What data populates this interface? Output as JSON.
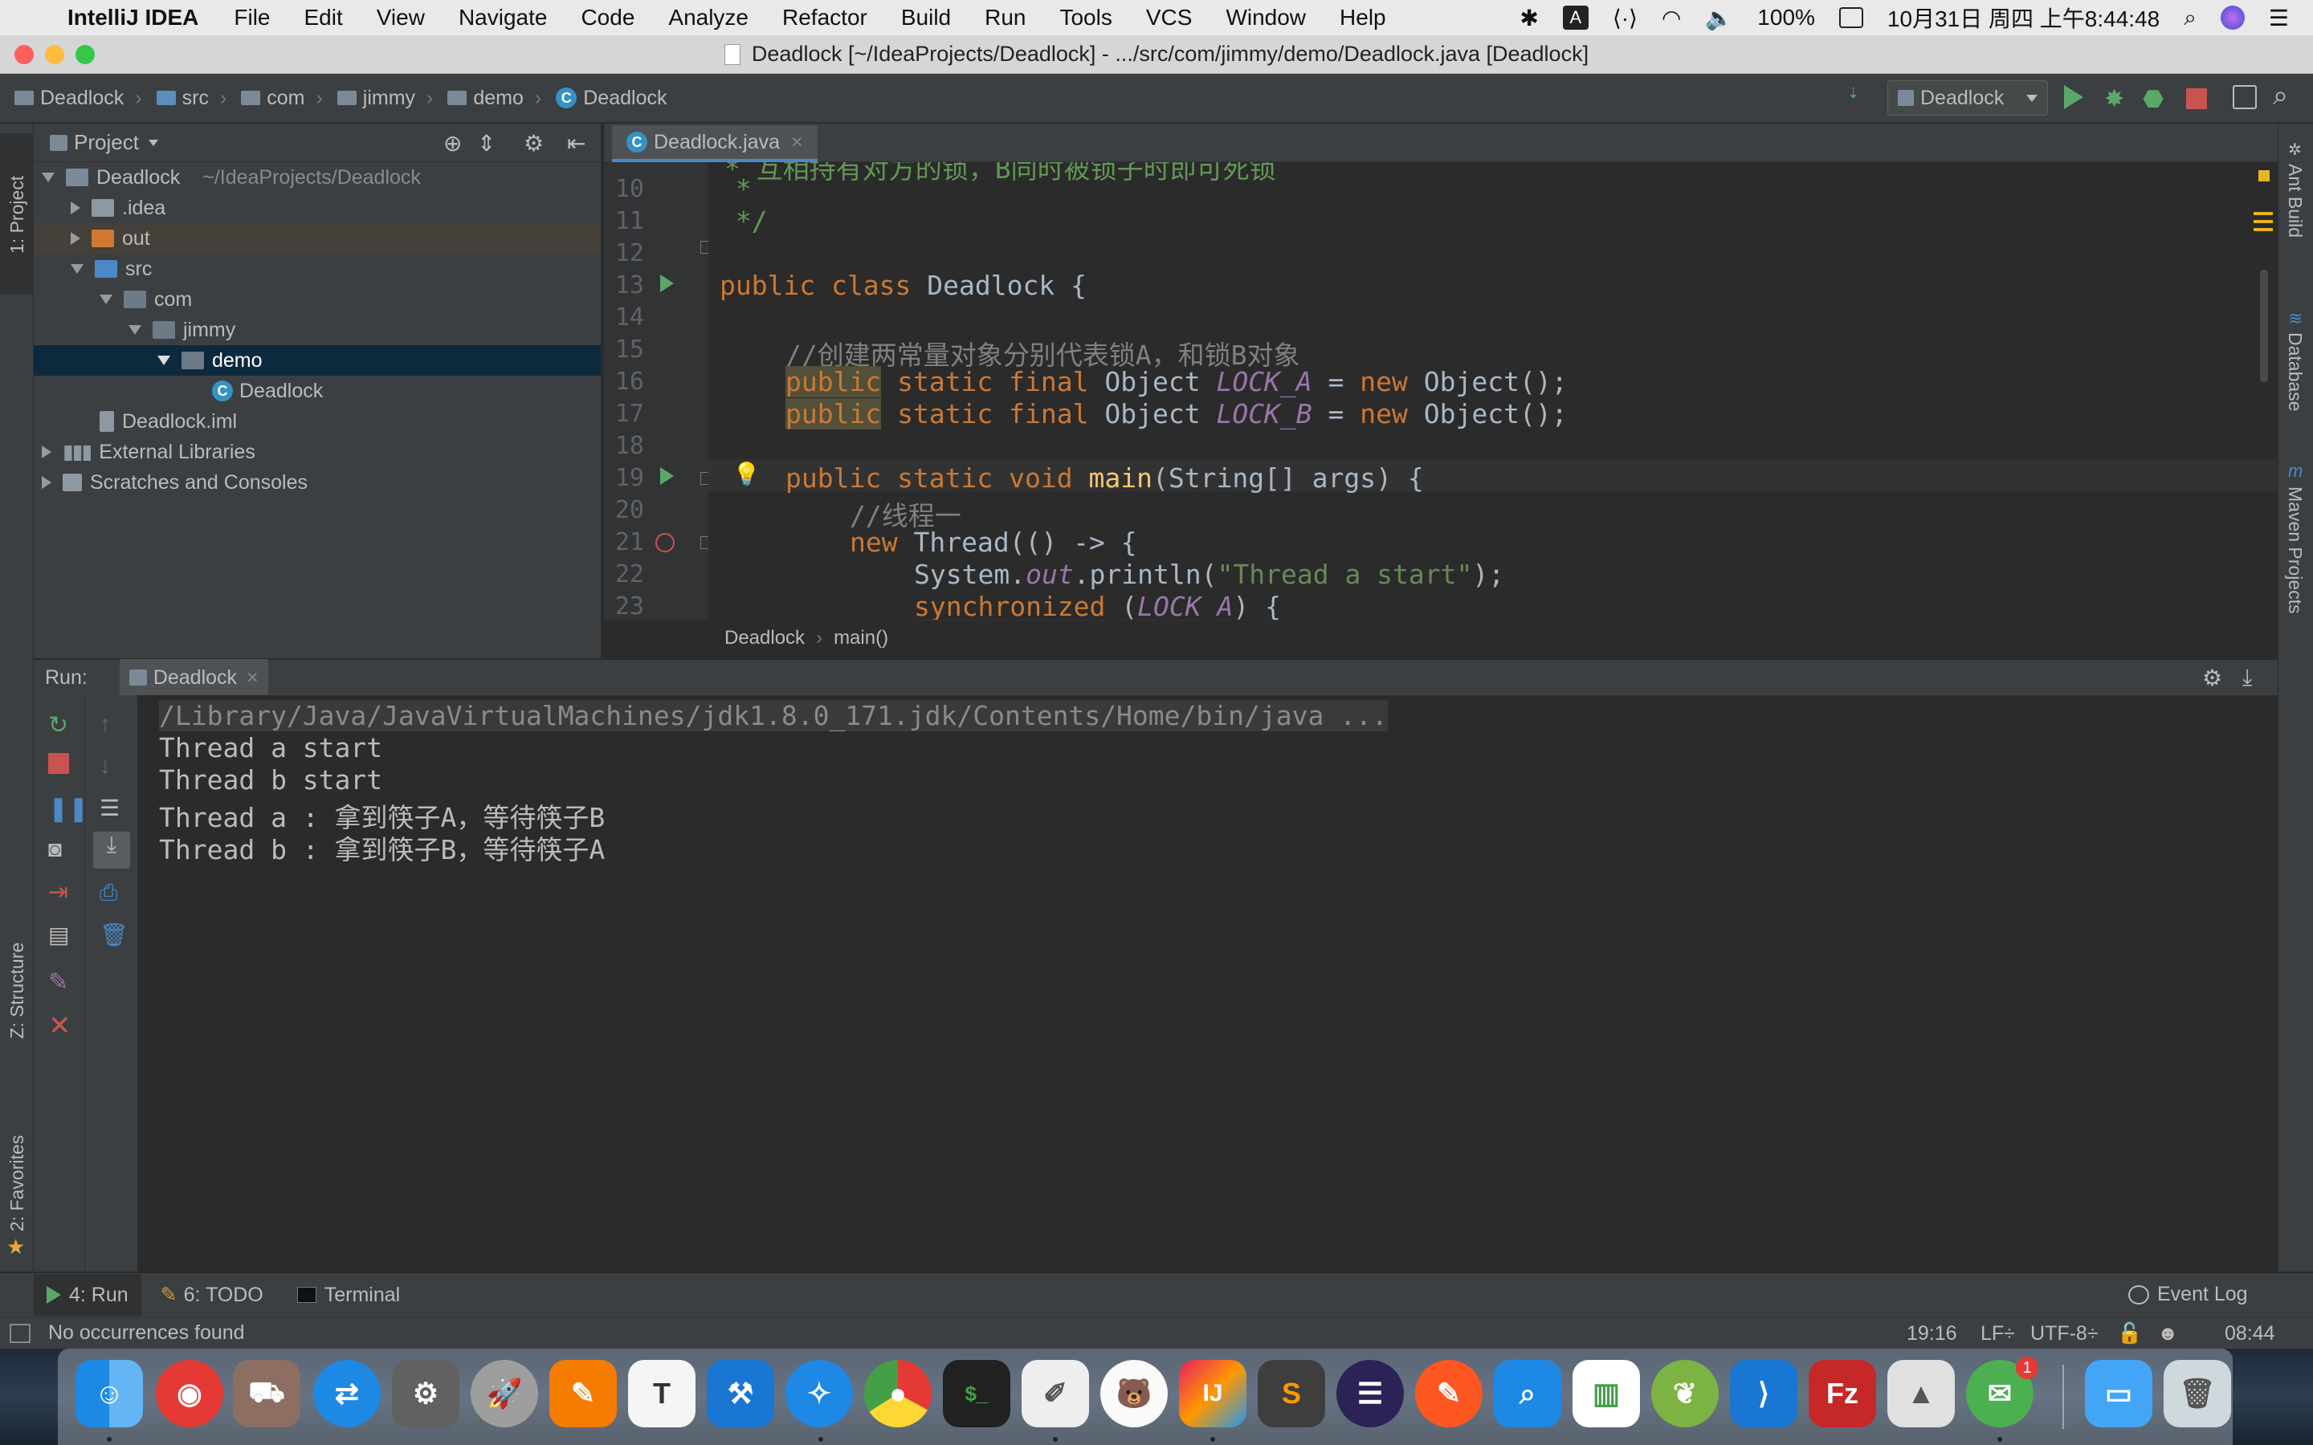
{
  "menubar": {
    "app_name": "IntelliJ IDEA",
    "items": [
      "File",
      "Edit",
      "View",
      "Navigate",
      "Code",
      "Analyze",
      "Refactor",
      "Build",
      "Run",
      "Tools",
      "VCS",
      "Window",
      "Help"
    ],
    "battery": "100%",
    "input_indicator": "A",
    "clock": "10月31日 周四 上午8:44:48"
  },
  "window": {
    "title": "Deadlock [~/IdeaProjects/Deadlock] - .../src/com/jimmy/demo/Deadlock.java [Deadlock]"
  },
  "navbar": {
    "crumbs": [
      "Deadlock",
      "src",
      "com",
      "jimmy",
      "demo",
      "Deadlock"
    ],
    "run_config": "Deadlock"
  },
  "left_strip": {
    "project": "1: Project",
    "structure": "Z: Structure",
    "favorites": "2: Favorites"
  },
  "right_strip": {
    "ant": "Ant Build",
    "database": "Database",
    "maven": "Maven Projects"
  },
  "project_panel": {
    "title": "Project",
    "tree": [
      {
        "label": "Deadlock",
        "path": "~/IdeaProjects/Deadlock",
        "icon": "module-folder-icon",
        "expanded": true
      },
      {
        "label": ".idea",
        "icon": "folder-icon",
        "expanded": false
      },
      {
        "label": "out",
        "icon": "excluded-folder-icon",
        "expanded": false
      },
      {
        "label": "src",
        "icon": "source-folder-icon",
        "expanded": true
      },
      {
        "label": "com",
        "icon": "package-icon",
        "expanded": true
      },
      {
        "label": "jimmy",
        "icon": "package-icon",
        "expanded": true
      },
      {
        "label": "demo",
        "icon": "package-icon",
        "expanded": true,
        "selected": true
      },
      {
        "label": "Deadlock",
        "icon": "java-class-icon"
      },
      {
        "label": "Deadlock.iml",
        "icon": "iml-file-icon"
      },
      {
        "label": "External Libraries",
        "icon": "libraries-icon",
        "expanded": false
      },
      {
        "label": "Scratches and Consoles",
        "icon": "scratches-icon",
        "expanded": false
      }
    ]
  },
  "editor": {
    "tab": "Deadlock.java",
    "line_numbers": [
      "10",
      "11",
      "12",
      "13",
      "14",
      "15",
      "16",
      "17",
      "18",
      "19",
      "20",
      "21",
      "22",
      "23"
    ],
    "partial_top_line": "* 互相持有对方的锁，B同时被锁子时即可死锁",
    "code": {
      "l10": " *",
      "l11": " */",
      "l13a": "public class ",
      "l13b": "Deadlock {",
      "l15": "//创建两常量对象分别代表锁A，和锁B对象",
      "l16a": "public",
      "l16b": " static final ",
      "l16c": "Object ",
      "l16d": "LOCK_A",
      "l16e": " = ",
      "l16f": "new ",
      "l16g": "Object();",
      "l17a": "public",
      "l17b": " static final ",
      "l17c": "Object ",
      "l17d": "LOCK_B",
      "l17e": " = ",
      "l17f": "new ",
      "l17g": "Object();",
      "l19a": "public static void ",
      "l19b": "main",
      "l19c": "(String[] args) {",
      "l20": "//线程一",
      "l21a": "new ",
      "l21b": "Thread(() -> {",
      "l22a": "System.",
      "l22b": "out",
      "l22c": ".println(",
      "l22d": "\"Thread a start\"",
      "l22e": ");",
      "l23a": "synchronized ",
      "l23b": "(",
      "l23c": "LOCK_A",
      "l23d": ") {"
    },
    "breadcrumb": [
      "Deadlock",
      "main()"
    ]
  },
  "run_panel": {
    "label": "Run:",
    "tab": "Deadlock",
    "output": [
      "/Library/Java/JavaVirtualMachines/jdk1.8.0_171.jdk/Contents/Home/bin/java ...",
      "Thread a start",
      "Thread b start",
      "Thread a : 拿到筷子A，等待筷子B",
      "Thread b : 拿到筷子B，等待筷子A"
    ]
  },
  "bottom_bar": {
    "run_tab": "4: Run",
    "todo_tab": "6: TODO",
    "terminal_tab": "Terminal",
    "event_log": "Event Log"
  },
  "status": {
    "message": "No occurrences found",
    "position": "19:16",
    "line_sep": "LF÷",
    "encoding": "UTF-8÷",
    "time": "08:44"
  },
  "dock": {
    "badge": "1",
    "apps": [
      "Finder",
      "NetEase Music",
      "Transmit",
      "TeamViewer",
      "System Preferences",
      "Launchpad",
      "Pages",
      "TextEdit",
      "Xcode",
      "Safari",
      "Chrome",
      "Terminal",
      "TextEdit Notes",
      "Bear",
      "IntelliJ IDEA",
      "Sublime Text",
      "Eclipse",
      "Paw",
      "Search",
      "Numbers",
      "Sequel",
      "VS Code",
      "FileZilla",
      "Preview",
      "WeChat",
      "Downloads",
      "Trash"
    ]
  },
  "colors": {
    "ide_bg": "#2b2b2b",
    "panel_bg": "#3c3f41",
    "keyword": "#cc7832",
    "comment": "#808080",
    "string": "#6a8759",
    "constant": "#9876aa",
    "method": "#ffc66d",
    "run_green": "#59a869",
    "stop_red": "#c75450"
  }
}
